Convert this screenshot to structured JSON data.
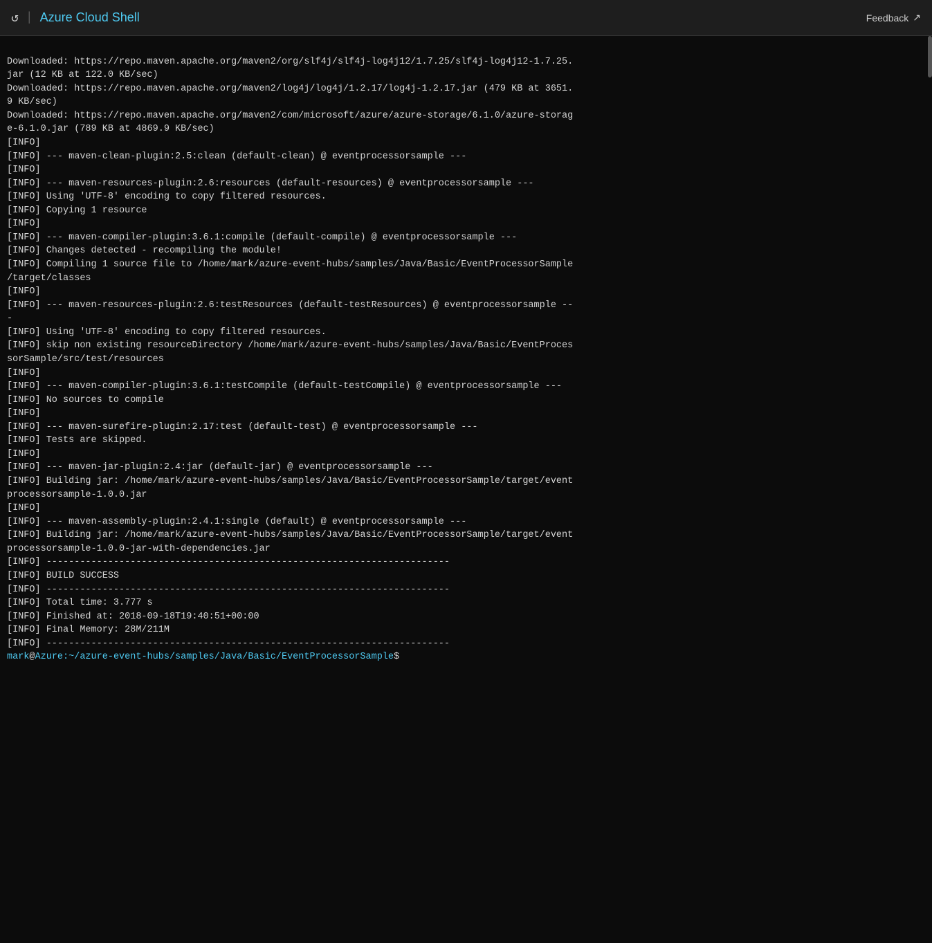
{
  "titleBar": {
    "appTitle": "Azure Cloud Shell",
    "feedbackLabel": "Feedback",
    "refreshIcon": "↺",
    "separator": "|",
    "externalLinkIcon": "↗"
  },
  "terminal": {
    "lines": [
      "Downloaded: https://repo.maven.apache.org/maven2/org/slf4j/slf4j-log4j12/1.7.25/slf4j-log4j12-1.7.25.",
      "jar (12 KB at 122.0 KB/sec)",
      "Downloaded: https://repo.maven.apache.org/maven2/log4j/log4j/1.2.17/log4j-1.2.17.jar (479 KB at 3651.",
      "9 KB/sec)",
      "Downloaded: https://repo.maven.apache.org/maven2/com/microsoft/azure/azure-storage/6.1.0/azure-storag",
      "e-6.1.0.jar (789 KB at 4869.9 KB/sec)",
      "[INFO]",
      "[INFO] --- maven-clean-plugin:2.5:clean (default-clean) @ eventprocessorsample ---",
      "[INFO]",
      "[INFO] --- maven-resources-plugin:2.6:resources (default-resources) @ eventprocessorsample ---",
      "[INFO] Using 'UTF-8' encoding to copy filtered resources.",
      "[INFO] Copying 1 resource",
      "[INFO]",
      "[INFO] --- maven-compiler-plugin:3.6.1:compile (default-compile) @ eventprocessorsample ---",
      "[INFO] Changes detected - recompiling the module!",
      "[INFO] Compiling 1 source file to /home/mark/azure-event-hubs/samples/Java/Basic/EventProcessorSample",
      "/target/classes",
      "[INFO]",
      "[INFO] --- maven-resources-plugin:2.6:testResources (default-testResources) @ eventprocessorsample --",
      "-",
      "[INFO] Using 'UTF-8' encoding to copy filtered resources.",
      "[INFO] skip non existing resourceDirectory /home/mark/azure-event-hubs/samples/Java/Basic/EventProces",
      "sorSample/src/test/resources",
      "[INFO]",
      "[INFO] --- maven-compiler-plugin:3.6.1:testCompile (default-testCompile) @ eventprocessorsample ---",
      "[INFO] No sources to compile",
      "[INFO]",
      "[INFO] --- maven-surefire-plugin:2.17:test (default-test) @ eventprocessorsample ---",
      "[INFO] Tests are skipped.",
      "[INFO]",
      "[INFO] --- maven-jar-plugin:2.4:jar (default-jar) @ eventprocessorsample ---",
      "[INFO] Building jar: /home/mark/azure-event-hubs/samples/Java/Basic/EventProcessorSample/target/event",
      "processorsample-1.0.0.jar",
      "[INFO]",
      "[INFO] --- maven-assembly-plugin:2.4.1:single (default) @ eventprocessorsample ---",
      "[INFO] Building jar: /home/mark/azure-event-hubs/samples/Java/Basic/EventProcessorSample/target/event",
      "processorsample-1.0.0-jar-with-dependencies.jar",
      "[INFO] ------------------------------------------------------------------------",
      "[INFO] BUILD SUCCESS",
      "[INFO] ------------------------------------------------------------------------",
      "[INFO] Total time: 3.777 s",
      "[INFO] Finished at: 2018-09-18T19:40:51+00:00",
      "[INFO] Final Memory: 28M/211M",
      "[INFO] ------------------------------------------------------------------------"
    ],
    "promptUser": "mark",
    "promptAt": "@",
    "promptHost": "Azure",
    "promptPath": ":~/azure-event-hubs/samples/Java/Basic/EventProcessorSample",
    "promptDollar": "$"
  }
}
